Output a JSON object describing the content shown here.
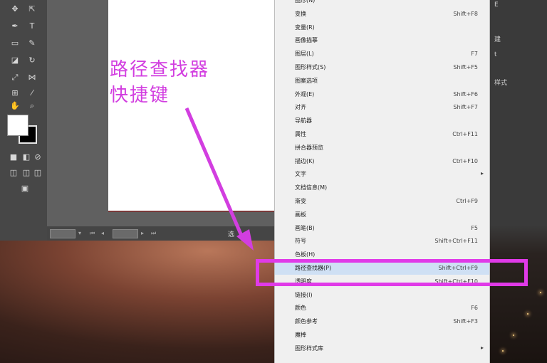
{
  "annotation": {
    "line1": "路径查找器",
    "line2": "快捷键"
  },
  "statusbar": {
    "zoom": "",
    "page": "",
    "label": "选"
  },
  "right_panel": {
    "t1": "E",
    "t2": "建",
    "t3": "t",
    "t4": "样式"
  },
  "colors": {
    "annotation": "#d23ee0",
    "menu_highlight": "#cfe0f4"
  },
  "menu": {
    "items": [
      {
        "label": "图形(N)",
        "shortcut": "",
        "submenu": false
      },
      {
        "label": "变换",
        "shortcut": "Shift+F8",
        "submenu": false
      },
      {
        "label": "变量(R)",
        "shortcut": "",
        "submenu": false
      },
      {
        "label": "画像描摹",
        "shortcut": "",
        "submenu": false
      },
      {
        "label": "图层(L)",
        "shortcut": "F7",
        "submenu": false
      },
      {
        "label": "图形样式(S)",
        "shortcut": "Shift+F5",
        "submenu": false
      },
      {
        "label": "图案选项",
        "shortcut": "",
        "submenu": false
      },
      {
        "label": "外观(E)",
        "shortcut": "Shift+F6",
        "submenu": false
      },
      {
        "label": "对齐",
        "shortcut": "Shift+F7",
        "submenu": false
      },
      {
        "label": "导航器",
        "shortcut": "",
        "submenu": false
      },
      {
        "label": "属性",
        "shortcut": "Ctrl+F11",
        "submenu": false
      },
      {
        "label": "拼合器预览",
        "shortcut": "",
        "submenu": false
      },
      {
        "label": "描边(K)",
        "shortcut": "Ctrl+F10",
        "submenu": false
      },
      {
        "label": "文字",
        "shortcut": "",
        "submenu": true
      },
      {
        "label": "文档信息(M)",
        "shortcut": "",
        "submenu": false
      },
      {
        "label": "渐变",
        "shortcut": "Ctrl+F9",
        "submenu": false
      },
      {
        "label": "画板",
        "shortcut": "",
        "submenu": false
      },
      {
        "label": "画笔(B)",
        "shortcut": "F5",
        "submenu": false
      },
      {
        "label": "符号",
        "shortcut": "Shift+Ctrl+F11",
        "submenu": false
      },
      {
        "label": "色板(H)",
        "shortcut": "",
        "submenu": false
      },
      {
        "label": "路径查找器(P)",
        "shortcut": "Shift+Ctrl+F9",
        "submenu": false,
        "highlighted": true
      },
      {
        "label": "透明度",
        "shortcut": "Shift+Ctrl+F10",
        "submenu": false
      },
      {
        "label": "链接(I)",
        "shortcut": "",
        "submenu": false
      },
      {
        "label": "颜色",
        "shortcut": "F6",
        "submenu": false
      },
      {
        "label": "颜色参考",
        "shortcut": "Shift+F3",
        "submenu": false
      },
      {
        "label": "魔棒",
        "shortcut": "",
        "submenu": false
      },
      {
        "label": "图形样式库",
        "shortcut": "",
        "submenu": true
      }
    ]
  }
}
